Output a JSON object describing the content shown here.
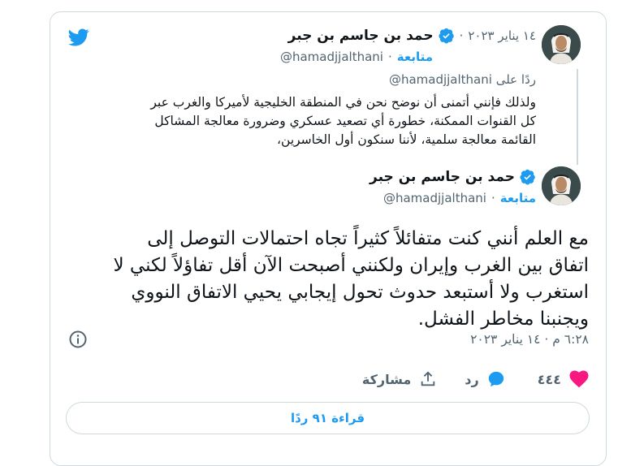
{
  "quoted_tweet": {
    "author_name": "حمد بن جاسم بن جبر",
    "date": "١٤ يناير ٢٠٢٣",
    "handle": "@hamadjjalthani",
    "follow_label": "متابعة",
    "reply_prefix": "ردًا على",
    "reply_to": "@hamadjjalthani",
    "text_lines": [
      "ولذلك فإنني أتمنى أن نوضح نحن في المنطقة الخليجية لأميركا والغرب عبر",
      "كل القنوات الممكنة، خطورة أي تصعيد عسكري وضرورة معالجة المشاكل",
      "القائمة معالجة سلمية، لأننا سنكون أول الخاسرين،"
    ]
  },
  "main_tweet": {
    "author_name": "حمد بن جاسم بن جبر",
    "handle": "@hamadjjalthani",
    "follow_label": "متابعة",
    "text_lines": [
      "مع العلم أنني كنت متفائلاً كثيراً تجاه احتمالات التوصل إلى",
      "اتفاق بين الغرب وإيران ولكنني أصبحت الآن أقل تفاؤلاً لكني لا",
      "استغرب ولا أستبعد حدوث تحول إيجابي يحيي الاتفاق النووي",
      "ويجنبنا مخاطر الفشل."
    ],
    "timestamp": "٦:٢٨ م · ١٤ يناير ٢٠٢٣"
  },
  "actions": {
    "likes": "٤٤٤",
    "reply_label": "رد",
    "share_label": "مشاركة"
  },
  "read_replies_label": "قراءة ٩١ ردًا",
  "colors": {
    "accent": "#1d9bf0",
    "like": "#f91880",
    "muted": "#536471",
    "border": "#cfd9de"
  },
  "icons": [
    "twitter-bird-icon",
    "verified-badge-icon",
    "info-icon",
    "heart-icon",
    "reply-icon",
    "share-icon"
  ]
}
